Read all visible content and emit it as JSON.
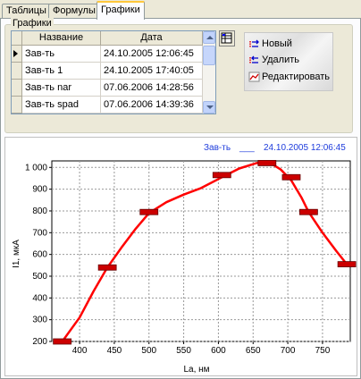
{
  "tabs": [
    {
      "label": "Таблицы"
    },
    {
      "label": "Формулы"
    },
    {
      "label": "Графики"
    }
  ],
  "group": {
    "caption": "Графики",
    "columns": {
      "name": "Название",
      "date": "Дата"
    },
    "rows": [
      {
        "name": "Зав-ть",
        "date": "24.10.2005 12:06:45",
        "current": true
      },
      {
        "name": "Зав-ть 1",
        "date": "24.10.2005 17:40:05"
      },
      {
        "name": "Зав-ть nar",
        "date": "07.06.2006 14:28:56"
      },
      {
        "name": "Зав-ть spad",
        "date": "07.06.2006 14:39:36"
      }
    ]
  },
  "toolbar": {
    "new_label": "Новый",
    "delete_label": "Удалить",
    "edit_label": "Редактировать",
    "icons": [
      "db-grid-icon",
      "new-icon",
      "delete-icon",
      "edit-chart-icon"
    ]
  },
  "chart_header": {
    "name": "Зав-ть",
    "separator": "___",
    "timestamp": "24.10.2005 12:06:45",
    "color": "#1e3cdc"
  },
  "chart_data": {
    "type": "line",
    "xlabel": "La, нм",
    "ylabel": "I1, мкА",
    "xlim": [
      360,
      790
    ],
    "ylim": [
      200,
      1030
    ],
    "x_ticks": [
      "400",
      "450",
      "500",
      "550",
      "600",
      "650",
      "700",
      "750"
    ],
    "y_ticks": [
      "200",
      "300",
      "400",
      "500",
      "600",
      "700",
      "800",
      "900",
      "1 000"
    ],
    "grid": true,
    "line_color": "#ff0000",
    "marker_color": "#cc0000",
    "points": [
      {
        "x": 375,
        "y": 200
      },
      {
        "x": 440,
        "y": 540
      },
      {
        "x": 500,
        "y": 795
      },
      {
        "x": 605,
        "y": 965
      },
      {
        "x": 670,
        "y": 1020
      },
      {
        "x": 705,
        "y": 955
      },
      {
        "x": 730,
        "y": 795
      },
      {
        "x": 785,
        "y": 555
      }
    ],
    "curve": [
      {
        "x": 375,
        "y": 200
      },
      {
        "x": 400,
        "y": 310
      },
      {
        "x": 420,
        "y": 430
      },
      {
        "x": 440,
        "y": 540
      },
      {
        "x": 460,
        "y": 630
      },
      {
        "x": 480,
        "y": 715
      },
      {
        "x": 500,
        "y": 790
      },
      {
        "x": 525,
        "y": 840
      },
      {
        "x": 550,
        "y": 875
      },
      {
        "x": 575,
        "y": 905
      },
      {
        "x": 605,
        "y": 955
      },
      {
        "x": 630,
        "y": 995
      },
      {
        "x": 655,
        "y": 1020
      },
      {
        "x": 675,
        "y": 1020
      },
      {
        "x": 690,
        "y": 990
      },
      {
        "x": 705,
        "y": 940
      },
      {
        "x": 720,
        "y": 860
      },
      {
        "x": 730,
        "y": 795
      },
      {
        "x": 750,
        "y": 700
      },
      {
        "x": 770,
        "y": 615
      },
      {
        "x": 785,
        "y": 555
      }
    ]
  }
}
